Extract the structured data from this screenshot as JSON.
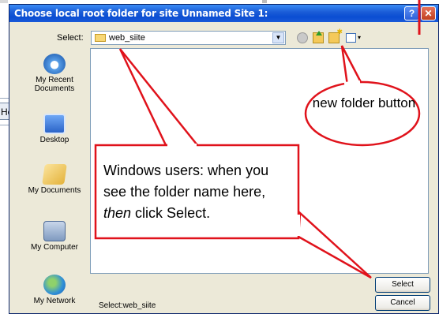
{
  "background": {
    "partial_tab_label": "He"
  },
  "dialog": {
    "title": "Choose local root folder for site Unnamed Site 1:",
    "help_label": "?",
    "close_label": "✕",
    "select_label": "Select:",
    "select_value": "web_siite",
    "places": [
      {
        "label": "My Recent Documents",
        "icon": "recent-documents-icon"
      },
      {
        "label": "Desktop",
        "icon": "desktop-icon"
      },
      {
        "label": "My Documents",
        "icon": "my-documents-icon"
      },
      {
        "label": "My Computer",
        "icon": "my-computer-icon"
      },
      {
        "label": "My Network",
        "icon": "my-network-icon"
      }
    ],
    "status_text": "Select:web_siite",
    "select_button": "Select",
    "cancel_button": "Cancel"
  },
  "annotations": {
    "callout_prefix": "Windows users: when you see the folder name here,",
    "callout_em": "then",
    "callout_suffix": " click Select.",
    "new_folder_label": "new folder button",
    "annotation_color": "#e0121b"
  }
}
